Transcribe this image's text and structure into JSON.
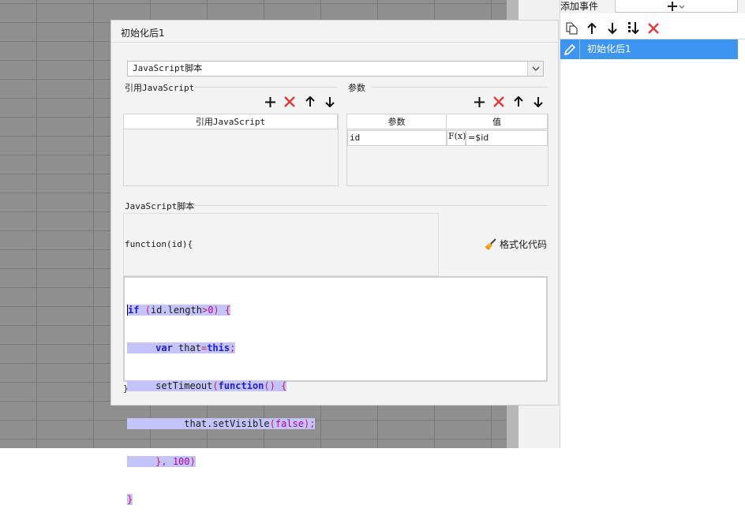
{
  "right_panel": {
    "add_event_label": "添加事件",
    "add_icon": "plus-icon",
    "toolbar": [
      "copy-icon",
      "arrow-up-icon",
      "arrow-down-icon",
      "sort-down-icon",
      "delete-icon"
    ],
    "events": [
      {
        "icon": "pencil-icon",
        "label": "初始化后1"
      }
    ]
  },
  "dialog": {
    "title": "初始化后1",
    "type_select": "JavaScript脚本",
    "ref_section": {
      "label": "引用JavaScript",
      "column": "引用JavaScript",
      "rows": []
    },
    "params_section": {
      "label": "参数",
      "columns": [
        "参数",
        "值"
      ],
      "rows": [
        {
          "name": "id",
          "value": "=$id"
        }
      ],
      "fx_label": "F(x)"
    },
    "script_section": {
      "label": "JavaScript脚本",
      "function_header": "function(id){",
      "format_button": "格式化代码",
      "closing": "}"
    },
    "toolbar_icons": [
      "plus-icon",
      "delete-icon",
      "arrow-up-icon",
      "arrow-down-icon"
    ]
  },
  "code": {
    "lines": [
      "if (id.length>0) {",
      "     var that=this;",
      "     setTimeout(function() {",
      "          that.setVisible(false);",
      "     }, 100)",
      "}"
    ]
  },
  "colors": {
    "selection": "#3e95f0",
    "delete": "#e23a3a",
    "code_highlight": "#c4c4fb"
  }
}
